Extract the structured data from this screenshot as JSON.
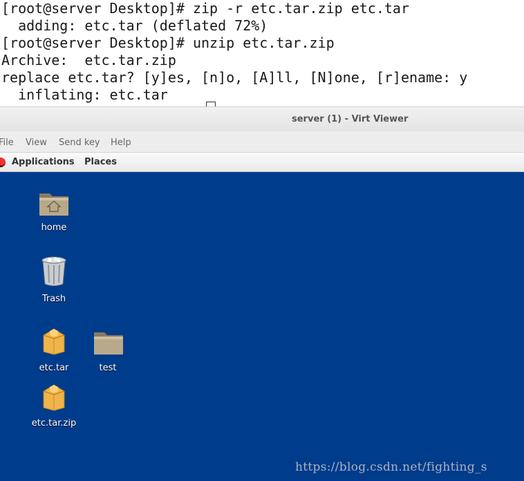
{
  "terminal": {
    "lines": [
      "[root@server Desktop]# zip -r etc.tar.zip etc.tar",
      "  adding: etc.tar (deflated 72%)",
      "[root@server Desktop]# unzip etc.tar.zip",
      "Archive:  etc.tar.zip",
      "replace etc.tar? [y]es, [n]o, [A]ll, [N]one, [r]ename: y",
      "  inflating: etc.tar"
    ]
  },
  "window": {
    "title": "server (1) - Virt Viewer",
    "menu": [
      "File",
      "View",
      "Send key",
      "Help"
    ]
  },
  "panel": {
    "applications": "Applications",
    "places": "Places"
  },
  "desktop": {
    "icons": [
      {
        "label": "home",
        "icon": "home-folder-icon"
      },
      {
        "label": "Trash",
        "icon": "trash-icon"
      },
      {
        "label": "etc.tar",
        "icon": "package-icon"
      },
      {
        "label": "test",
        "icon": "folder-icon"
      },
      {
        "label": "etc.tar.zip",
        "icon": "package-icon"
      }
    ]
  },
  "watermark": "https://blog.csdn.net/fighting_s",
  "colors": {
    "desktop_bg": "#003c8c",
    "folder": "#b9a98a",
    "package": "#f0b54a"
  }
}
